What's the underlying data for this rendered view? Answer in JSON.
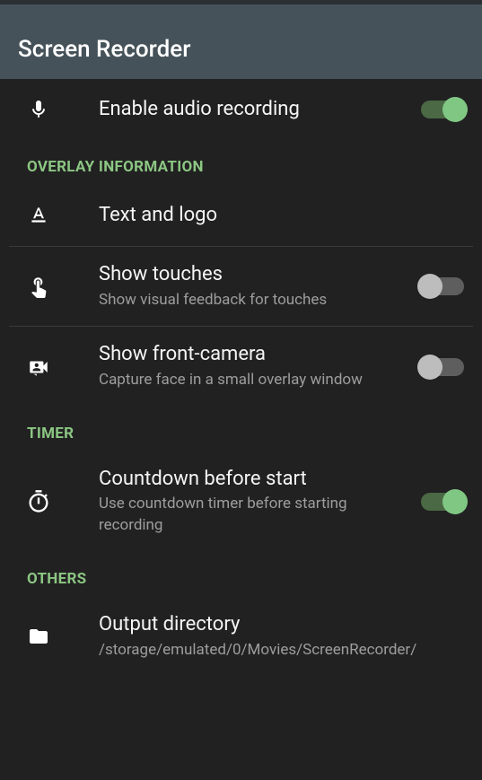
{
  "header": {
    "title": "Screen Recorder"
  },
  "sections": {
    "overlay_information": "OVERLAY INFORMATION",
    "timer": "TIMER",
    "others": "OTHERS"
  },
  "items": {
    "enable_audio": {
      "title": "Enable audio recording",
      "enabled": true
    },
    "text_and_logo": {
      "title": "Text and logo"
    },
    "show_touches": {
      "title": "Show touches",
      "subtitle": "Show visual feedback for touches",
      "enabled": false
    },
    "show_front_camera": {
      "title": "Show front-camera",
      "subtitle": "Capture face in a small overlay window",
      "enabled": false
    },
    "countdown": {
      "title": "Countdown before start",
      "subtitle": "Use countdown timer before starting recording",
      "enabled": true
    },
    "output_directory": {
      "title": "Output directory",
      "subtitle": "/storage/emulated/0/Movies/ScreenRecorder/"
    }
  }
}
